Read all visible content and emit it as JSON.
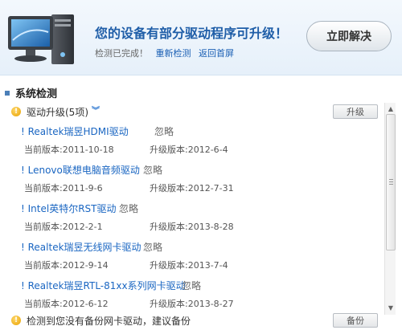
{
  "header": {
    "headline": "您的设备有部分驱动程序可升级！",
    "status": "检测已完成！",
    "rescan_link": "重新检测",
    "home_link": "返回首屏",
    "fix_button": "立即解决"
  },
  "section": {
    "title": "系统检测"
  },
  "upgrade_group": {
    "label": "驱动升级(5项)",
    "button": "升级"
  },
  "drivers": [
    {
      "name": "! Realtek瑞昱HDMI驱动",
      "ignore": "忽略",
      "current": "当前版本:2011-10-18",
      "upgrade": "升级版本:2012-6-4"
    },
    {
      "name": "! Lenovo联想电脑音频驱动",
      "ignore": "忽略",
      "current": "当前版本:2011-9-6",
      "upgrade": "升级版本:2012-7-31"
    },
    {
      "name": "! Intel英特尔RST驱动",
      "ignore": "忽略",
      "current": "当前版本:2012-2-1",
      "upgrade": "升级版本:2013-8-28"
    },
    {
      "name": "! Realtek瑞昱无线网卡驱动",
      "ignore": "忽略",
      "current": "当前版本:2012-9-14",
      "upgrade": "升级版本:2013-7-4"
    },
    {
      "name": "! Realtek瑞昱RTL-81xx系列网卡驱动",
      "ignore": "忽略",
      "current": "当前版本:2012-6-12",
      "upgrade": "升级版本:2013-8-27"
    }
  ],
  "backup": {
    "label": "检测到您没有备份网卡驱动，建议备份",
    "button": "备份"
  },
  "icons": {
    "warning": "warning-icon",
    "computer": "computer-illustration",
    "chevron": "double-chevron-down-icon"
  },
  "colors": {
    "link": "#1a66c2",
    "headline": "#1f5ea8",
    "warning": "#e8a100"
  }
}
